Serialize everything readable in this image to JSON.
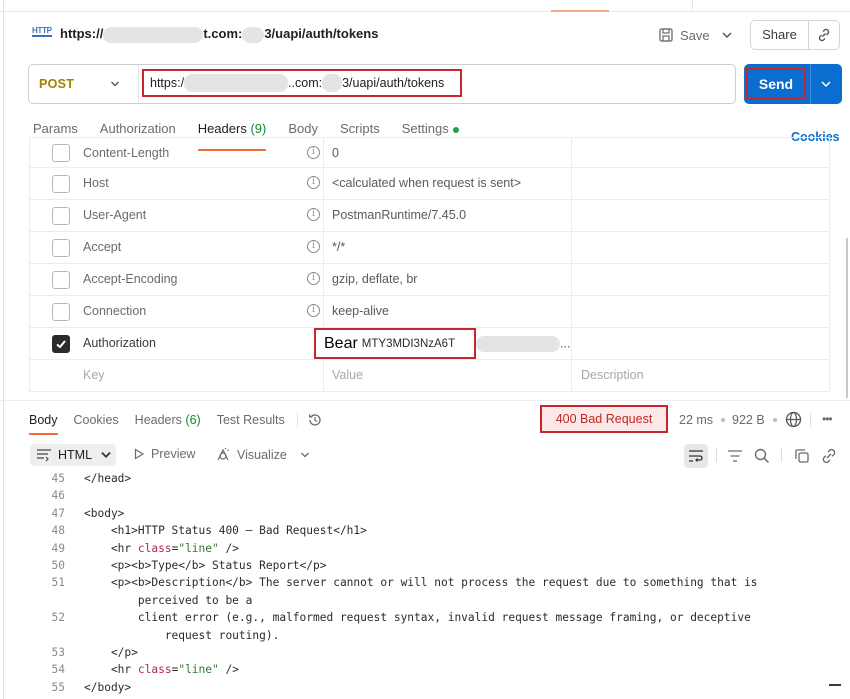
{
  "title_row": {
    "url_prefix": "https://",
    "url_mid": "t.com:",
    "url_suffix": "3/uapi/auth/tokens",
    "http_icon_label": "HTTP",
    "save_label": "Save",
    "share_label": "Share"
  },
  "request": {
    "method": "POST",
    "url_prefix": "https:/",
    "url_mid": "..com:",
    "url_suffix": "3/uapi/auth/tokens",
    "send_label": "Send"
  },
  "request_tabs": [
    {
      "label": "Params"
    },
    {
      "label": "Authorization"
    },
    {
      "label": "Headers",
      "count": "(9)"
    },
    {
      "label": "Body"
    },
    {
      "label": "Scripts"
    },
    {
      "label": "Settings"
    }
  ],
  "cookies_label": "Cookies",
  "headers": [
    {
      "key": "Content-Length",
      "value": "0",
      "checked": false
    },
    {
      "key": "Host",
      "value": "<calculated when request is sent>",
      "checked": false
    },
    {
      "key": "User-Agent",
      "value": "PostmanRuntime/7.45.0",
      "checked": false
    },
    {
      "key": "Accept",
      "value": "*/*",
      "checked": false
    },
    {
      "key": "Accept-Encoding",
      "value": "gzip, deflate, br",
      "checked": false
    },
    {
      "key": "Connection",
      "value": "keep-alive",
      "checked": false
    },
    {
      "key": "Authorization",
      "value_word": "Bear",
      "value_token": "MTY3MDI3NzA6T",
      "value_tail": "...",
      "checked": true
    }
  ],
  "header_placeholders": {
    "key": "Key",
    "value": "Value",
    "description": "Description"
  },
  "response_tabs": [
    {
      "label": "Body"
    },
    {
      "label": "Cookies"
    },
    {
      "label": "Headers",
      "count": "(6)"
    },
    {
      "label": "Test Results"
    }
  ],
  "response_meta": {
    "status": "400 Bad Request",
    "time": "22 ms",
    "size": "922 B"
  },
  "response_toolbar": {
    "format": "HTML",
    "preview": "Preview",
    "visualize": "Visualize"
  },
  "code_lines": [
    {
      "num": "45",
      "text": "</head>"
    },
    {
      "num": "46",
      "text": ""
    },
    {
      "num": "47",
      "text": "<body>"
    },
    {
      "num": "48",
      "text": "    <h1>HTTP Status 400 – Bad Request</h1>"
    },
    {
      "num": "49",
      "pre": "    <hr ",
      "attr": "class",
      "eq": "=",
      "str": "\"line\"",
      "post": " />"
    },
    {
      "num": "50",
      "text": "    <p><b>Type</b> Status Report</p>"
    },
    {
      "num": "51",
      "text": "    <p><b>Description</b> The server cannot or will not process the request due to something that is"
    },
    {
      "num": "",
      "text": "        perceived to be a"
    },
    {
      "num": "52",
      "text": "        client error (e.g., malformed request syntax, invalid request message framing, or deceptive"
    },
    {
      "num": "",
      "text": "            request routing)."
    },
    {
      "num": "53",
      "text": "    </p>"
    },
    {
      "num": "54",
      "pre": "    <hr ",
      "attr": "class",
      "eq": "=",
      "str": "\"line\"",
      "post": " />"
    },
    {
      "num": "55",
      "text": "</body>"
    }
  ],
  "colors": {
    "accent": "#0a6ed1",
    "highlight_border": "#c8262d",
    "tab_underline": "#f26b3a",
    "count_green": "#0f8a2e",
    "method_color": "#a08000"
  }
}
